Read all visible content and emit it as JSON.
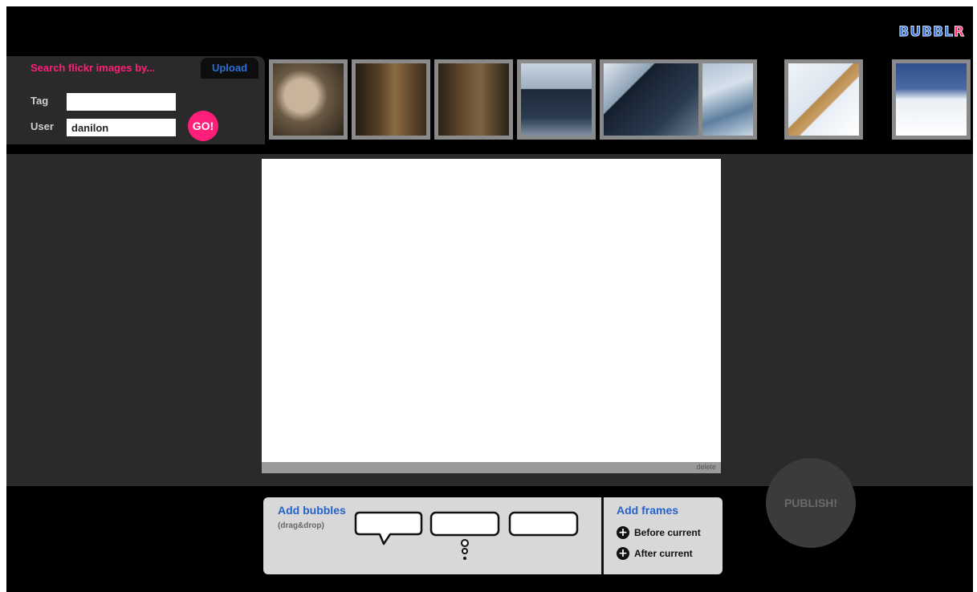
{
  "app": {
    "logo_main": "BUBBL",
    "logo_accent": "R"
  },
  "search": {
    "title": "Search flickr images by...",
    "upload_tab": "Upload",
    "tag_label": "Tag",
    "tag_value": "",
    "user_label": "User",
    "user_value": "danilon",
    "go_label": "GO!"
  },
  "thumbnails": [
    {
      "name": "smiling-woman-photo",
      "color_a": "#3b3326",
      "color_b": "#b39a77"
    },
    {
      "name": "hallway-person-photo-1",
      "color_a": "#2a2016",
      "color_b": "#7a5a33"
    },
    {
      "name": "hallway-person-photo-2",
      "color_a": "#2b2217",
      "color_b": "#6e5634"
    },
    {
      "name": "street-sign-photo",
      "color_a": "#1e2a3a",
      "color_b": "#c7d3df"
    },
    {
      "name": "bare-feet-snow-photo",
      "color_a": "#5f7f9e",
      "color_b": "#c9d7e5"
    },
    {
      "name": "sled-snow-photo",
      "color_a": "#e6eef5",
      "color_b": "#b88a4a"
    },
    {
      "name": "snowy-field-photo",
      "color_a": "#2f4f8c",
      "color_b": "#e9eff5"
    }
  ],
  "canvas": {
    "delete_label": "delete"
  },
  "bubbles": {
    "title": "Add bubbles",
    "subtitle": "(drag&drop)"
  },
  "frames": {
    "title": "Add frames",
    "before_label": "Before current",
    "after_label": "After current"
  },
  "publish": {
    "label": "PUBLISH!"
  },
  "colors": {
    "pink": "#ff1f7a",
    "blue": "#2563c9",
    "panel": "#2a2a2a",
    "background": "#000000"
  }
}
